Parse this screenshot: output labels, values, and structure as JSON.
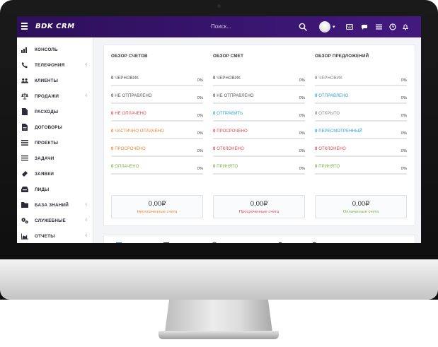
{
  "app": {
    "logo": "BDK CRM"
  },
  "topbar": {
    "search_placeholder": "Поиск..."
  },
  "sidebar": {
    "items": [
      {
        "label": "КОНСОЛЬ",
        "icon": "bar-chart-icon",
        "has_caret": false
      },
      {
        "label": "ТЕЛЕФОНИЯ",
        "icon": "phone-icon",
        "has_caret": true
      },
      {
        "label": "КЛИЕНТЫ",
        "icon": "users-icon",
        "has_caret": false
      },
      {
        "label": "ПРОДАЖИ",
        "icon": "scales-icon",
        "has_caret": true
      },
      {
        "label": "РАСХОДЫ",
        "icon": "document-icon",
        "has_caret": false
      },
      {
        "label": "ДОГОВОРЫ",
        "icon": "contract-icon",
        "has_caret": false
      },
      {
        "label": "ПРОЕКТЫ",
        "icon": "list-icon",
        "has_caret": false
      },
      {
        "label": "ЗАДАЧИ",
        "icon": "tasks-icon",
        "has_caret": false
      },
      {
        "label": "ЗАЯВКИ",
        "icon": "ticket-icon",
        "has_caret": false
      },
      {
        "label": "ЛИДЫ",
        "icon": "inbox-icon",
        "has_caret": false
      },
      {
        "label": "БАЗА ЗНАНИЙ",
        "icon": "folder-icon",
        "has_caret": true
      },
      {
        "label": "СЛУЖЕБНЫЕ",
        "icon": "gears-icon",
        "has_caret": true
      },
      {
        "label": "ОТЧЕТЫ",
        "icon": "area-chart-icon",
        "has_caret": true
      }
    ]
  },
  "overview": {
    "columns": [
      {
        "title": "ОБЗОР СЧЕТОВ",
        "rows": [
          {
            "count": "0",
            "label": "ЧЕРНОВИК",
            "pct": "0%",
            "color": "#555555"
          },
          {
            "count": "0",
            "label": "НЕ ОТПРАВЛЕНО",
            "pct": "0%",
            "color": "#555555"
          },
          {
            "count": "0",
            "label": "НЕ ОПЛАЧЕНО",
            "pct": "0%",
            "color": "#e2474a"
          },
          {
            "count": "0",
            "label": "ЧАСТИЧНО ОПЛАЧЕНО",
            "pct": "0%",
            "color": "#f0862f"
          },
          {
            "count": "0",
            "label": "ПРОСРОЧЕНО",
            "pct": "0%",
            "color": "#f0862f"
          },
          {
            "count": "0",
            "label": "ОПЛАЧЕНО",
            "pct": "0%",
            "color": "#7cb342"
          }
        ],
        "summary": {
          "value": "0,00₽",
          "label": "Неоплаченные счета",
          "color": "#f0862f"
        }
      },
      {
        "title": "ОБЗОР СМЕТ",
        "rows": [
          {
            "count": "0",
            "label": "ЧЕРНОВИК",
            "pct": "0%",
            "color": "#555555"
          },
          {
            "count": "0",
            "label": "НЕ ОТПРАВЛЕНО",
            "pct": "0%",
            "color": "#555555"
          },
          {
            "count": "0",
            "label": "ОТПРАВИТЬ",
            "pct": "0%",
            "color": "#2aa1e0"
          },
          {
            "count": "0",
            "label": "ПРОСРОЧЕНО",
            "pct": "0%",
            "color": "#e2474a"
          },
          {
            "count": "0",
            "label": "ОТКЛОНЕНО",
            "pct": "0%",
            "color": "#e2474a"
          },
          {
            "count": "0",
            "label": "ПРИНЯТО",
            "pct": "0%",
            "color": "#7cb342"
          }
        ],
        "summary": {
          "value": "0,00₽",
          "label": "Просроченные счета",
          "color": "#e2474a"
        }
      },
      {
        "title": "ОБЗОР ПРЕДЛОЖЕНИЙ",
        "rows": [
          {
            "count": "0",
            "label": "ЧЕРНОВИК",
            "pct": "0%",
            "color": "#888888"
          },
          {
            "count": "0",
            "label": "ОТПРАВЛЕНО",
            "pct": "0%",
            "color": "#2aa1e0"
          },
          {
            "count": "0",
            "label": "ОТКРЫТО",
            "pct": "0%",
            "color": "#888888"
          },
          {
            "count": "0",
            "label": "ПЕРЕСМОТРЕННЫЙ",
            "pct": "0%",
            "color": "#2aa1e0"
          },
          {
            "count": "0",
            "label": "ОТКЛОНЕНО",
            "pct": "0%",
            "color": "#e2474a"
          },
          {
            "count": "0",
            "label": "ПРИНЯТО",
            "pct": "0%",
            "color": "#7cb342"
          }
        ],
        "summary": {
          "value": "0,00₽",
          "label": "Оплаченные счета",
          "color": "#7cb342"
        }
      }
    ]
  },
  "colors": {
    "topbar": "#3a1570",
    "accent_purple": "#43197e"
  }
}
